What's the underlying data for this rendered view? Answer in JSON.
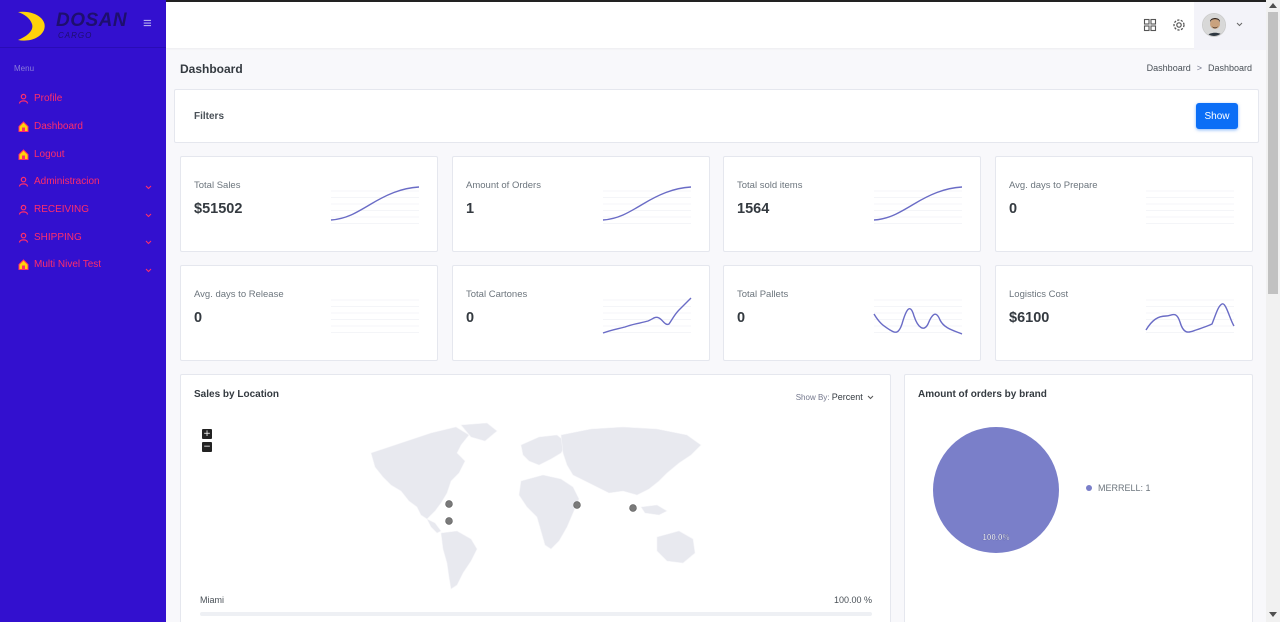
{
  "sidebar": {
    "brand": {
      "name": "DOSAN",
      "sub": "CARGO"
    },
    "menu_title": "Menu",
    "items": [
      {
        "label": "Profile",
        "icon": "user-icon",
        "has_children": false
      },
      {
        "label": "Dashboard",
        "icon": "home-icon",
        "has_children": false
      },
      {
        "label": "Logout",
        "icon": "home-icon",
        "has_children": false
      },
      {
        "label": "Administracion",
        "icon": "user-icon",
        "has_children": true
      },
      {
        "label": "RECEIVING",
        "icon": "user-icon",
        "has_children": true
      },
      {
        "label": "SHIPPING",
        "icon": "user-icon",
        "has_children": true
      },
      {
        "label": "Multi Nivel Test",
        "icon": "home-icon",
        "has_children": true
      }
    ]
  },
  "header": {
    "title": "Dashboard",
    "breadcrumb": [
      "Dashboard",
      "Dashboard"
    ],
    "breadcrumb_sep": ">"
  },
  "filters": {
    "title": "Filters",
    "show_label": "Show"
  },
  "stats": [
    {
      "label": "Total Sales",
      "value": "$51502",
      "spark": "s-curve"
    },
    {
      "label": "Amount of Orders",
      "value": "1",
      "spark": "s-curve"
    },
    {
      "label": "Total sold items",
      "value": "1564",
      "spark": "s-curve"
    },
    {
      "label": "Avg. days to Prepare",
      "value": "0",
      "spark": "none"
    },
    {
      "label": "Avg. days to Release",
      "value": "0",
      "spark": "none"
    },
    {
      "label": "Total Cartones",
      "value": "0",
      "spark": "rising-wiggle"
    },
    {
      "label": "Total Pallets",
      "value": "0",
      "spark": "oscillating"
    },
    {
      "label": "Logistics Cost",
      "value": "$6100",
      "spark": "oscillating-2"
    }
  ],
  "sales_location": {
    "title": "Sales by Location",
    "show_by_label": "Show By:",
    "show_by_value": "Percent",
    "zoom_in": "+",
    "zoom_out": "−",
    "row_label": "Miami",
    "row_value": "100.00 %"
  },
  "brand_orders": {
    "title": "Amount of orders by brand",
    "legend": [
      {
        "name": "MERRELL",
        "value": 1,
        "text": "MERRELL: 1",
        "color": "#7a7fc9"
      }
    ],
    "slice_label": "100.0%"
  },
  "chart_data": {
    "type": "pie",
    "title": "Amount of orders by brand",
    "categories": [
      "MERRELL"
    ],
    "values": [
      1
    ],
    "labels": [
      "100.0%"
    ]
  },
  "colors": {
    "sidebar_bg": "#3310cf",
    "menu_text": "#ff2d6a",
    "primary": "#0b6ef6",
    "sparkline": "#6a6cc6"
  }
}
